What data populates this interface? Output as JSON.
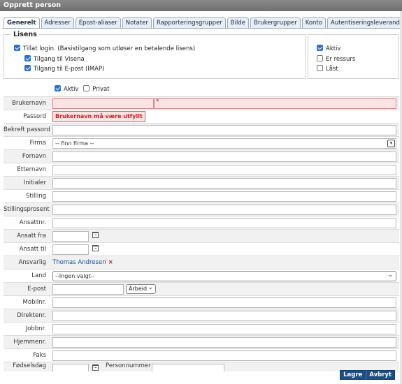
{
  "window": {
    "title": "Opprett person"
  },
  "tabs": [
    {
      "label": "Generelt",
      "active": true
    },
    {
      "label": "Adresser"
    },
    {
      "label": "Epost-aliaser"
    },
    {
      "label": "Notater"
    },
    {
      "label": "Rapporteringsgrupper"
    },
    {
      "label": "Bilde"
    },
    {
      "label": "Brukergrupper"
    },
    {
      "label": "Konto"
    },
    {
      "label": "Autentiseringsleverandører"
    }
  ],
  "lisens": {
    "legend": "Lisens",
    "allow_login": {
      "label": "Tillat login. (Basistilgang som utløser en betalende lisens)",
      "checked": true
    },
    "visena": {
      "label": "Tilgang til Visena",
      "checked": true
    },
    "imap": {
      "label": "Tilgang til E-post (IMAP)",
      "checked": true
    }
  },
  "status": {
    "aktiv": {
      "label": "Aktiv",
      "checked": true
    },
    "ressurs": {
      "label": "Er ressurs",
      "checked": false
    },
    "last": {
      "label": "Låst",
      "checked": false
    }
  },
  "flags": {
    "aktiv": {
      "label": "Aktiv",
      "checked": true
    },
    "privat": {
      "label": "Privat",
      "checked": false
    }
  },
  "form": {
    "brukernavn": {
      "label": "Brukernavn",
      "value": "",
      "required_mark": "*"
    },
    "passord": {
      "label": "Passord",
      "error": "Brukernavn må være utfyllt"
    },
    "bekreft_passord": {
      "label": "Bekreft passord",
      "value": ""
    },
    "firma": {
      "label": "Firma",
      "value": "-- finn firma --"
    },
    "fornavn": {
      "label": "Fornavn",
      "value": ""
    },
    "etternavn": {
      "label": "Etternavn",
      "value": ""
    },
    "initialer": {
      "label": "Initialer",
      "value": ""
    },
    "stilling": {
      "label": "Stilling",
      "value": ""
    },
    "stillingsprosent": {
      "label": "Stillingsprosent",
      "value": ""
    },
    "ansattnr": {
      "label": "Ansattnr.",
      "value": ""
    },
    "ansatt_fra": {
      "label": "Ansatt fra",
      "value": ""
    },
    "ansatt_til": {
      "label": "Ansatt til",
      "value": ""
    },
    "ansvarlig": {
      "label": "Ansvarlig",
      "value": "Thomas Andresen",
      "remove": "×"
    },
    "land": {
      "label": "Land",
      "value": "--Ingen valgt--"
    },
    "epost": {
      "label": "E-post",
      "value": "",
      "type": "Arbeid"
    },
    "mobilnr": {
      "label": "Mobilnr.",
      "value": ""
    },
    "direktenr": {
      "label": "Direktenr.",
      "value": ""
    },
    "jobbnr": {
      "label": "Jobbnr.",
      "value": ""
    },
    "hjemmenr": {
      "label": "Hjemmenr.",
      "value": ""
    },
    "faks": {
      "label": "Faks",
      "value": ""
    },
    "fodselsdag": {
      "label": "Fødselsdag",
      "value": ""
    },
    "personnummer": {
      "label": "Personnummer",
      "value": ""
    }
  },
  "actions": {
    "save": "Lagre",
    "cancel": "Avbryt"
  }
}
